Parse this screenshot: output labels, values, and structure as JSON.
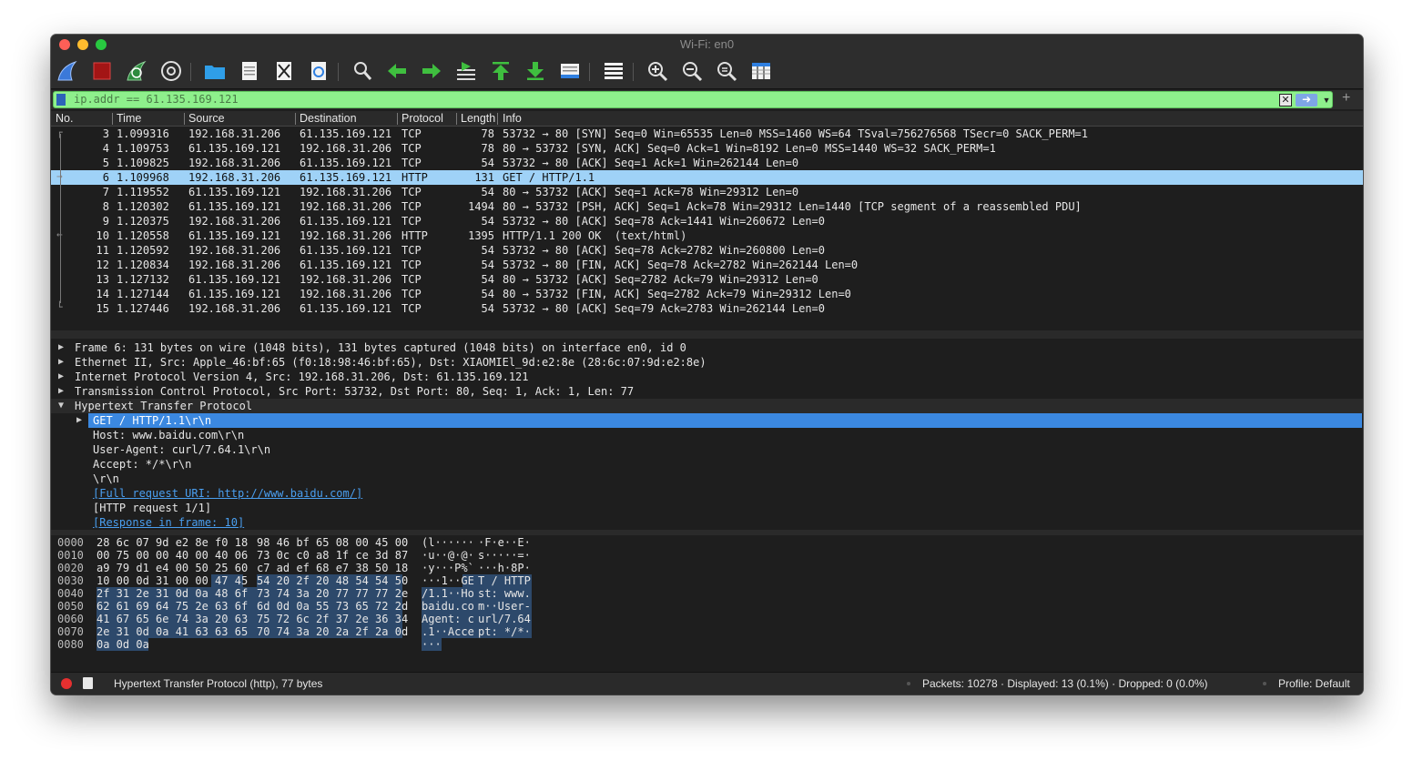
{
  "window": {
    "title": "Wi-Fi: en0"
  },
  "filter": {
    "text": "ip.addr == 61.135.169.121",
    "add_label": "+"
  },
  "columns": [
    "No.",
    "Time",
    "Source",
    "Destination",
    "Protocol",
    "Length",
    "Info"
  ],
  "packets": [
    {
      "no": "3",
      "time": "1.099316",
      "src": "192.168.31.206",
      "dst": "61.135.169.121",
      "proto": "TCP",
      "len": "78",
      "info": "53732 → 80 [SYN] Seq=0 Win=65535 Len=0 MSS=1460 WS=64 TSval=756276568 TSecr=0 SACK_PERM=1"
    },
    {
      "no": "4",
      "time": "1.109753",
      "src": "61.135.169.121",
      "dst": "192.168.31.206",
      "proto": "TCP",
      "len": "78",
      "info": "80 → 53732 [SYN, ACK] Seq=0 Ack=1 Win=8192 Len=0 MSS=1440 WS=32 SACK_PERM=1"
    },
    {
      "no": "5",
      "time": "1.109825",
      "src": "192.168.31.206",
      "dst": "61.135.169.121",
      "proto": "TCP",
      "len": "54",
      "info": "53732 → 80 [ACK] Seq=1 Ack=1 Win=262144 Len=0"
    },
    {
      "no": "6",
      "time": "1.109968",
      "src": "192.168.31.206",
      "dst": "61.135.169.121",
      "proto": "HTTP",
      "len": "131",
      "info": "GET / HTTP/1.1"
    },
    {
      "no": "7",
      "time": "1.119552",
      "src": "61.135.169.121",
      "dst": "192.168.31.206",
      "proto": "TCP",
      "len": "54",
      "info": "80 → 53732 [ACK] Seq=1 Ack=78 Win=29312 Len=0"
    },
    {
      "no": "8",
      "time": "1.120302",
      "src": "61.135.169.121",
      "dst": "192.168.31.206",
      "proto": "TCP",
      "len": "1494",
      "info": "80 → 53732 [PSH, ACK] Seq=1 Ack=78 Win=29312 Len=1440 [TCP segment of a reassembled PDU]"
    },
    {
      "no": "9",
      "time": "1.120375",
      "src": "192.168.31.206",
      "dst": "61.135.169.121",
      "proto": "TCP",
      "len": "54",
      "info": "53732 → 80 [ACK] Seq=78 Ack=1441 Win=260672 Len=0"
    },
    {
      "no": "10",
      "time": "1.120558",
      "src": "61.135.169.121",
      "dst": "192.168.31.206",
      "proto": "HTTP",
      "len": "1395",
      "info": "HTTP/1.1 200 OK  (text/html)"
    },
    {
      "no": "11",
      "time": "1.120592",
      "src": "192.168.31.206",
      "dst": "61.135.169.121",
      "proto": "TCP",
      "len": "54",
      "info": "53732 → 80 [ACK] Seq=78 Ack=2782 Win=260800 Len=0"
    },
    {
      "no": "12",
      "time": "1.120834",
      "src": "192.168.31.206",
      "dst": "61.135.169.121",
      "proto": "TCP",
      "len": "54",
      "info": "53732 → 80 [FIN, ACK] Seq=78 Ack=2782 Win=262144 Len=0"
    },
    {
      "no": "13",
      "time": "1.127132",
      "src": "61.135.169.121",
      "dst": "192.168.31.206",
      "proto": "TCP",
      "len": "54",
      "info": "80 → 53732 [ACK] Seq=2782 Ack=79 Win=29312 Len=0"
    },
    {
      "no": "14",
      "time": "1.127144",
      "src": "61.135.169.121",
      "dst": "192.168.31.206",
      "proto": "TCP",
      "len": "54",
      "info": "80 → 53732 [FIN, ACK] Seq=2782 Ack=79 Win=29312 Len=0"
    },
    {
      "no": "15",
      "time": "1.127446",
      "src": "192.168.31.206",
      "dst": "61.135.169.121",
      "proto": "TCP",
      "len": "54",
      "info": "53732 → 80 [ACK] Seq=79 Ack=2783 Win=262144 Len=0"
    }
  ],
  "selected_packet": "6",
  "details": [
    "Frame 6: 131 bytes on wire (1048 bits), 131 bytes captured (1048 bits) on interface en0, id 0",
    "Ethernet II, Src: Apple_46:bf:65 (f0:18:98:46:bf:65), Dst: XIAOMIEl_9d:e2:8e (28:6c:07:9d:e2:8e)",
    "Internet Protocol Version 4, Src: 192.168.31.206, Dst: 61.135.169.121",
    "Transmission Control Protocol, Src Port: 53732, Dst Port: 80, Seq: 1, Ack: 1, Len: 77",
    "Hypertext Transfer Protocol"
  ],
  "http_fields": [
    "GET / HTTP/1.1\\r\\n",
    "Host: www.baidu.com\\r\\n",
    "User-Agent: curl/7.64.1\\r\\n",
    "Accept: */*\\r\\n",
    "\\r\\n",
    "[Full request URI: http://www.baidu.com/]",
    "[HTTP request 1/1]",
    "[Response in frame: 10]"
  ],
  "hex": [
    {
      "off": "0000",
      "b1": "28 6c 07 9d e2 8e f0 18",
      "b2": "98 46 bf 65 08 00 45 00",
      "a1": "(l······",
      "a2": "·F·e··E·"
    },
    {
      "off": "0010",
      "b1": "00 75 00 00 40 00 40 06",
      "b2": "73 0c c0 a8 1f ce 3d 87",
      "a1": "·u··@·@·",
      "a2": "s·····=·"
    },
    {
      "off": "0020",
      "b1": "a9 79 d1 e4 00 50 25 60",
      "b2": "c7 ad ef 68 e7 38 50 18",
      "a1": "·y···P%`",
      "a2": "···h·8P·"
    },
    {
      "off": "0030",
      "b1": "10 00 0d 31 00 00 47 45",
      "b2": "54 20 2f 20 48 54 54 50",
      "a1": "···1··GE",
      "a2": "T / HTTP"
    },
    {
      "off": "0040",
      "b1": "2f 31 2e 31 0d 0a 48 6f",
      "b2": "73 74 3a 20 77 77 77 2e",
      "a1": "/1.1··Ho",
      "a2": "st: www."
    },
    {
      "off": "0050",
      "b1": "62 61 69 64 75 2e 63 6f",
      "b2": "6d 0d 0a 55 73 65 72 2d",
      "a1": "baidu.co",
      "a2": "m··User-"
    },
    {
      "off": "0060",
      "b1": "41 67 65 6e 74 3a 20 63",
      "b2": "75 72 6c 2f 37 2e 36 34",
      "a1": "Agent: c",
      "a2": "url/7.64"
    },
    {
      "off": "0070",
      "b1": "2e 31 0d 0a 41 63 63 65",
      "b2": "70 74 3a 20 2a 2f 2a 0d",
      "a1": ".1··Acce",
      "a2": "pt: */*·"
    },
    {
      "off": "0080",
      "b1": "0a 0d 0a",
      "b2": "",
      "a1": "···",
      "a2": ""
    }
  ],
  "status": {
    "left": "Hypertext Transfer Protocol (http), 77 bytes",
    "packets": "Packets: 10278 · Displayed: 13 (0.1%) · Dropped: 0 (0.0%)",
    "profile": "Profile: Default"
  },
  "colors": {
    "selected_row": "#9fd2f7",
    "selected_detail": "#3b88e0",
    "filter_valid": "#8ef08c"
  },
  "toolbar_icons": [
    "shark-fin-start-icon",
    "stop-capture-icon",
    "restart-capture-icon",
    "capture-options-icon",
    "open-file-icon",
    "save-file-icon",
    "close-file-icon",
    "reload-file-icon",
    "find-packet-icon",
    "go-back-icon",
    "go-forward-icon",
    "go-to-packet-icon",
    "first-packet-icon",
    "last-packet-icon",
    "auto-scroll-icon",
    "colorize-icon",
    "zoom-in-icon",
    "zoom-out-icon",
    "normal-size-icon",
    "resize-columns-icon"
  ]
}
